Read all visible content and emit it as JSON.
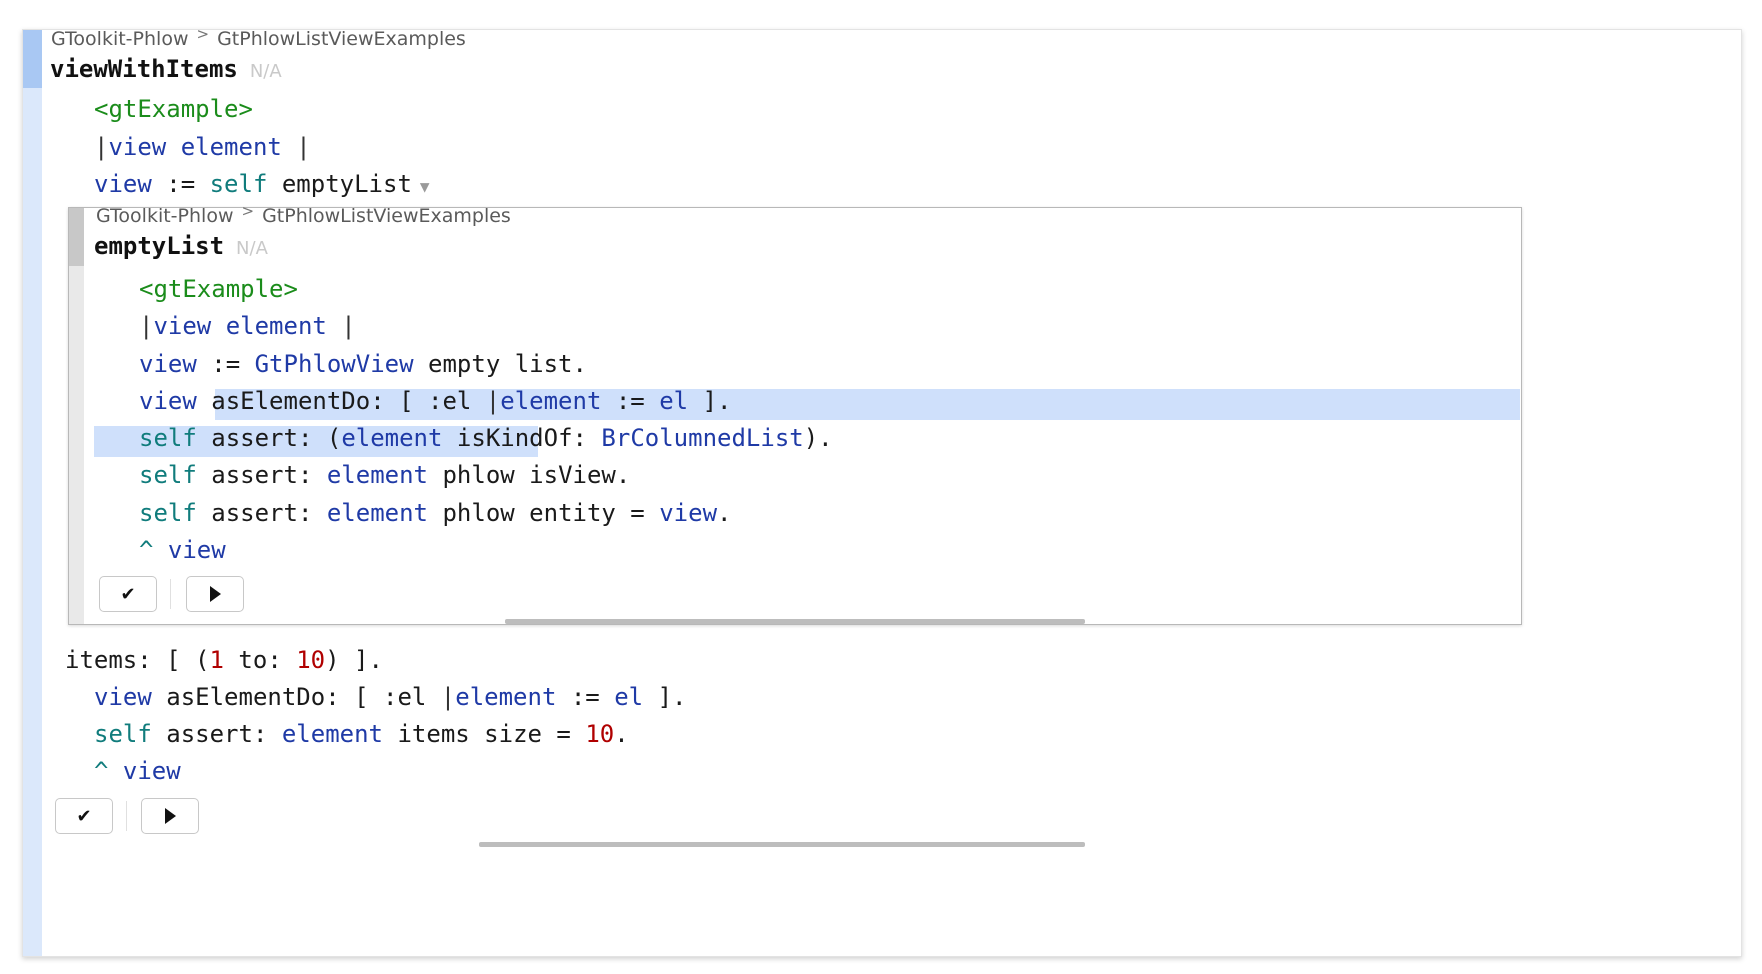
{
  "outer": {
    "breadcrumb": {
      "package": "GToolkit-Phlow",
      "separator": ">",
      "class": "GtPhlowListViewExamples"
    },
    "method": {
      "name": "viewWithItems",
      "status": "N/A"
    },
    "lines": {
      "pragma": "<gtExample>",
      "temps": {
        "open": "|",
        "vars": "view element",
        "close": "|"
      },
      "assign": {
        "var": "view",
        "op": ":=",
        "receiver": "self",
        "selector": "emptyList",
        "expand": "▼"
      }
    },
    "tail": {
      "items": {
        "kw": "items:",
        "open": "[ (",
        "from": "1",
        "to_kw": "to:",
        "to": "10",
        "close": ") ]."
      },
      "do": {
        "var": "view",
        "sel": "asElementDo:",
        "open": "[ :el",
        "pipe": "|",
        "el": "element",
        "op": ":=",
        "arg": "el",
        "close": "]."
      },
      "assert": {
        "self": "self",
        "sel": "assert:",
        "el": "element",
        "rest": "items size =",
        "num": "10",
        "end": "."
      },
      "ret": {
        "caret": "^",
        "var": "view"
      }
    },
    "buttons": {
      "check": "✔",
      "run": "run-icon"
    }
  },
  "inner": {
    "breadcrumb": {
      "package": "GToolkit-Phlow",
      "separator": ">",
      "class": "GtPhlowListViewExamples"
    },
    "method": {
      "name": "emptyList",
      "status": "N/A"
    },
    "lines": {
      "pragma": "<gtExample>",
      "temps": {
        "open": "|",
        "vars": "view element",
        "close": "|"
      },
      "l3": {
        "var": "view",
        "op": ":=",
        "cls": "GtPhlowView",
        "rest": "empty list."
      },
      "l4": {
        "var": "view",
        "sel": "asElementDo:",
        "open": "[ :el",
        "pipe": "|",
        "el": "element",
        "op": ":=",
        "arg": "el",
        "close": "]."
      },
      "l5": {
        "self": "self",
        "sel": "assert:",
        "open": "(",
        "el": "element",
        "msg": "isKindOf:",
        "cls": "BrColumnedList",
        "close": ")."
      },
      "l6": {
        "self": "self",
        "sel": "assert:",
        "el": "element",
        "rest": "phlow isView."
      },
      "l7": {
        "self": "self",
        "sel": "assert:",
        "el": "element",
        "rest": "phlow entity =",
        "var": "view",
        "end": "."
      },
      "l8": {
        "caret": "^",
        "var": "view"
      }
    },
    "buttons": {
      "check": "✔",
      "run": "run-icon"
    }
  }
}
